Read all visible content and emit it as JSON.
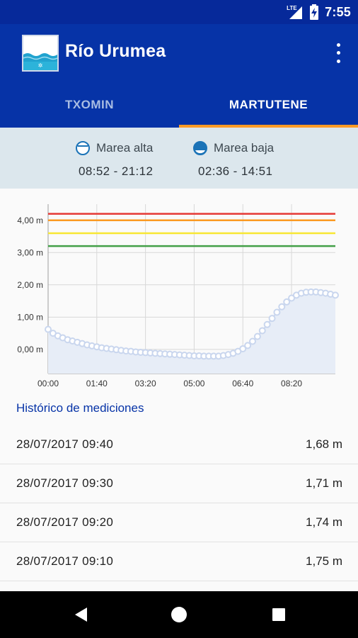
{
  "status_bar": {
    "time": "7:55",
    "network": "LTE"
  },
  "app_bar": {
    "title": "Río Urumea"
  },
  "tabs": [
    {
      "label": "TXOMIN",
      "active": false
    },
    {
      "label": "MARTUTENE",
      "active": true
    }
  ],
  "tides": {
    "high": {
      "label": "Marea alta",
      "times": "08:52 - 21:12"
    },
    "low": {
      "label": "Marea baja",
      "times": "02:36 - 14:51"
    }
  },
  "chart_data": {
    "type": "line",
    "title": "",
    "xlabel": "",
    "ylabel": "",
    "x_ticks": [
      "00:00",
      "01:40",
      "03:20",
      "05:00",
      "06:40",
      "08:20"
    ],
    "y_ticks": [
      "0,00 m",
      "1,00 m",
      "2,00 m",
      "3,00 m",
      "4,00 m"
    ],
    "ylim": [
      -0.75,
      4.5
    ],
    "xlim_minutes": [
      0,
      590
    ],
    "unit": "m",
    "thresholds": [
      {
        "value": 4.2,
        "color": "#e53935"
      },
      {
        "value": 4.0,
        "color": "#fb9a22"
      },
      {
        "value": 3.6,
        "color": "#f7e733"
      },
      {
        "value": 3.2,
        "color": "#43a047"
      }
    ],
    "series": [
      {
        "name": "",
        "x_minutes": [
          0,
          10,
          20,
          30,
          40,
          50,
          60,
          70,
          80,
          90,
          100,
          110,
          120,
          130,
          140,
          150,
          160,
          170,
          180,
          190,
          200,
          210,
          220,
          230,
          240,
          250,
          260,
          270,
          280,
          290,
          300,
          310,
          320,
          330,
          340,
          350,
          360,
          370,
          380,
          390,
          400,
          410,
          420,
          430,
          440,
          450,
          460,
          470,
          480,
          490,
          500,
          510,
          520,
          530,
          540,
          550,
          560,
          570,
          580,
          590
        ],
        "values": [
          0.62,
          0.5,
          0.42,
          0.36,
          0.3,
          0.26,
          0.22,
          0.18,
          0.14,
          0.11,
          0.08,
          0.05,
          0.03,
          0.01,
          -0.01,
          -0.03,
          -0.05,
          -0.06,
          -0.08,
          -0.09,
          -0.1,
          -0.11,
          -0.12,
          -0.13,
          -0.14,
          -0.15,
          -0.16,
          -0.17,
          -0.18,
          -0.19,
          -0.2,
          -0.2,
          -0.21,
          -0.21,
          -0.21,
          -0.21,
          -0.19,
          -0.16,
          -0.12,
          -0.06,
          0.02,
          0.12,
          0.25,
          0.4,
          0.58,
          0.77,
          0.96,
          1.15,
          1.32,
          1.47,
          1.59,
          1.68,
          1.74,
          1.77,
          1.78,
          1.78,
          1.76,
          1.74,
          1.71,
          1.68
        ]
      }
    ],
    "colors": {
      "series_line": "#c9d6ee",
      "series_fill": "#e7edf7",
      "grid": "#d8d8d8"
    }
  },
  "history": {
    "title": "Histórico de mediciones",
    "rows": [
      {
        "datetime": "28/07/2017 09:40",
        "value": "1,68 m"
      },
      {
        "datetime": "28/07/2017 09:30",
        "value": "1,71 m"
      },
      {
        "datetime": "28/07/2017 09:20",
        "value": "1,74 m"
      },
      {
        "datetime": "28/07/2017 09:10",
        "value": "1,75 m"
      }
    ]
  },
  "colors": {
    "primary": "#0633a7",
    "accent": "#ff9b26",
    "tide_panel": "#dce7ed",
    "history_title": "#0633a7"
  },
  "icons": {
    "app": "river-logo-icon",
    "menu": "more-vert-icon",
    "high_tide": "high-tide-icon",
    "low_tide": "low-tide-icon",
    "nav_back": "back-triangle-icon",
    "nav_home": "home-circle-icon",
    "nav_recents": "recents-square-icon"
  }
}
